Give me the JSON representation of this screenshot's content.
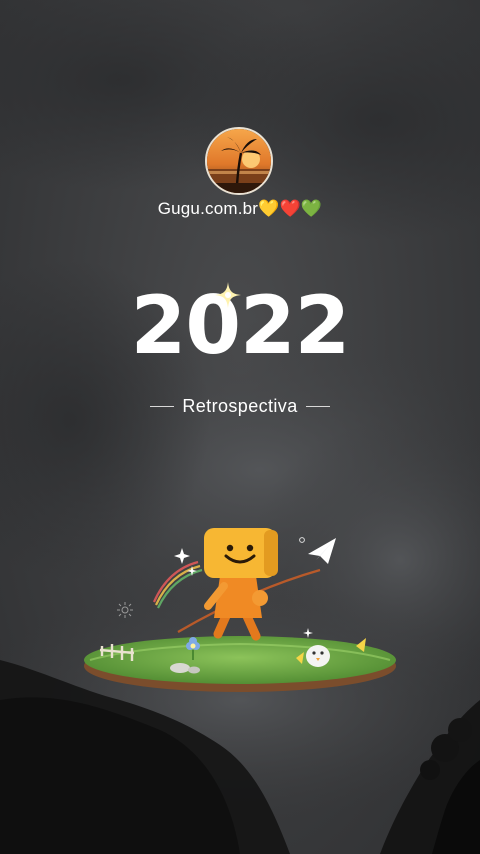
{
  "profile": {
    "username": "Gugu.com.br💛❤️💚"
  },
  "banner": {
    "year": "2022",
    "subtitle": "Retrospectiva"
  },
  "colors": {
    "background": "#3a3b3d",
    "text": "#ffffff",
    "mascot_head": "#f7b733",
    "mascot_body": "#f08a24",
    "grass": "#6fa843",
    "soil": "#8a5a3a"
  },
  "icons": {
    "avatar": "palm-sunset-avatar",
    "sparkle": "sparkle-icon",
    "paper_plane": "paper-plane-icon",
    "mascot": "smiley-box-mascot",
    "bird": "bird-icon",
    "flower": "flower-icon"
  }
}
